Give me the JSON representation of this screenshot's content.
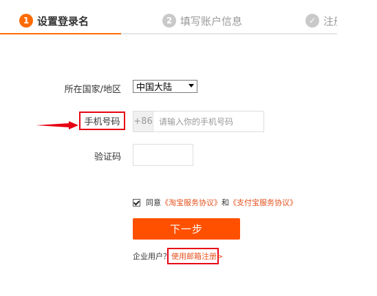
{
  "steps": [
    {
      "num": "1",
      "label": "设置登录名"
    },
    {
      "num": "2",
      "label": "填写账户信息"
    },
    {
      "label": "注册"
    }
  ],
  "form": {
    "country_label": "所在国家/地区",
    "country_value": "中国大陆",
    "phone_label": "手机号码",
    "phone_prefix": "+86",
    "phone_placeholder": "请输入你的手机号码",
    "code_label": "验证码"
  },
  "agreement": {
    "prefix": "同意",
    "link1": "《淘宝服务协议》",
    "and": "和",
    "link2": "《支付宝服务协议》"
  },
  "next_label": "下一步",
  "enterprise": {
    "label": "企业用户？",
    "link": "使用邮箱注册>"
  },
  "colors": {
    "accent": "#ff6a00",
    "button": "#ff5000",
    "highlight": "#e60012",
    "link": "#e5511d"
  }
}
